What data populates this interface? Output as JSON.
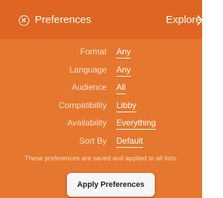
{
  "header": {
    "title": "Preferences",
    "close_icon": "close-circle-icon",
    "explore_label": "Explore",
    "explore_icon": "chevron-right-icon"
  },
  "preferences": [
    {
      "label": "Format",
      "value": "Any"
    },
    {
      "label": "Language",
      "value": "Any"
    },
    {
      "label": "Audience",
      "value": "All"
    },
    {
      "label": "Compatibility",
      "value": "Libby"
    },
    {
      "label": "Availability",
      "value": "Everything"
    },
    {
      "label": "Sort By",
      "value": "Default"
    }
  ],
  "note": "These preferences are saved and applied to all lists.",
  "apply_button": {
    "label": "Apply Preferences"
  },
  "colors": {
    "panel_background": "#e6772e",
    "header_background": "#de6622",
    "text": "#ffffff",
    "button_background": "#f6f6f6",
    "button_text": "#222222"
  }
}
